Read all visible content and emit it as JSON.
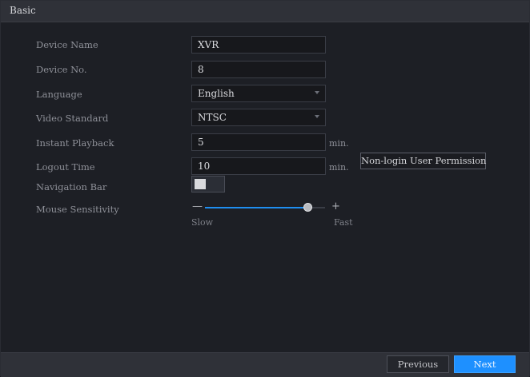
{
  "window": {
    "title": "Basic"
  },
  "settings": {
    "device_name": {
      "label": "Device Name",
      "value": "XVR"
    },
    "device_no": {
      "label": "Device No.",
      "value": "8"
    },
    "language": {
      "label": "Language",
      "value": "English"
    },
    "video_standard": {
      "label": "Video Standard",
      "value": "NTSC"
    },
    "instant_playback": {
      "label": "Instant Playback",
      "value": "5",
      "unit": "min."
    },
    "logout_time": {
      "label": "Logout Time",
      "value": "10",
      "unit": "min."
    },
    "non_login_permission_button": "Non-login User Permission",
    "navigation_bar": {
      "label": "Navigation Bar",
      "enabled": true
    },
    "mouse_sensitivity": {
      "label": "Mouse Sensitivity",
      "level": 0.85,
      "minus_symbol": "—",
      "plus_symbol": "+",
      "slow_label": "Slow",
      "fast_label": "Fast"
    }
  },
  "footer": {
    "previous_label": "Previous",
    "next_label": "Next"
  },
  "colors": {
    "accent": "#1e90ff",
    "background": "#1d1f25",
    "bar": "#2f3138"
  },
  "icons": {
    "dropdown_arrow": "triangle-down"
  }
}
